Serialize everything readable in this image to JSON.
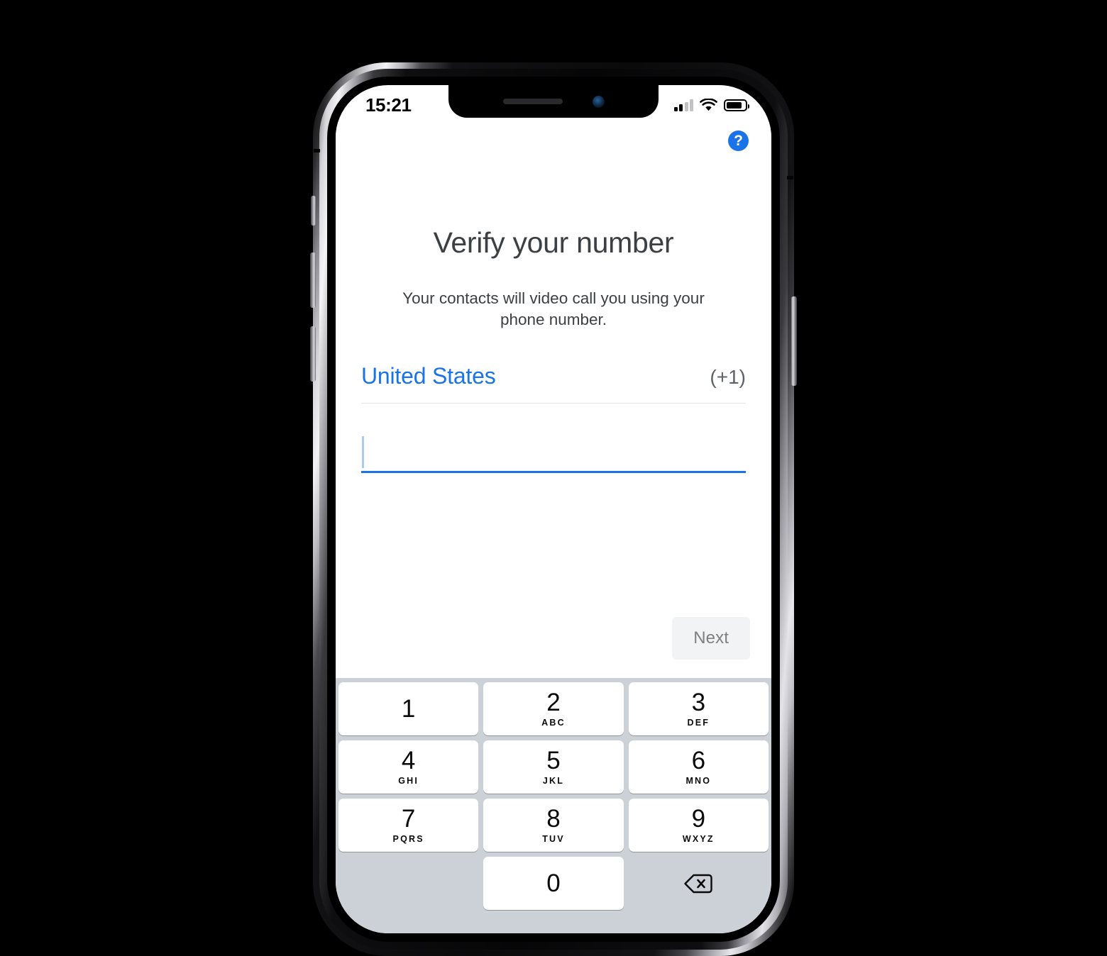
{
  "device": {
    "status_bar": {
      "time": "15:21",
      "signal_icon": "cellular-signal-icon",
      "signal_bars_filled": 2,
      "signal_bars_total": 4,
      "wifi_icon": "wifi-icon",
      "battery_icon": "battery-icon",
      "battery_level_pct": 84
    },
    "notch": {
      "speaker_icon": "earpiece-speaker-icon",
      "camera_icon": "front-camera-icon"
    }
  },
  "app": {
    "help_button": {
      "label": "?",
      "icon": "help-question-icon",
      "color": "#1a73e8"
    },
    "title": "Verify your number",
    "subtitle": "Your contacts will video call you using your phone number.",
    "country": {
      "name": "United States",
      "dial_code": "(+1)",
      "name_color": "#1a73e8",
      "code_color": "#5f6368"
    },
    "phone_input": {
      "value": "",
      "placeholder": "",
      "underline_color": "#1a73e8",
      "caret_color": "#a8cbf5"
    },
    "next_button": {
      "label": "Next",
      "enabled": false,
      "bg_color": "#f1f3f4",
      "text_color": "#7d8084"
    }
  },
  "keypad": {
    "background_color": "#ccd1d7",
    "rows": [
      [
        {
          "num": "1",
          "sub": ""
        },
        {
          "num": "2",
          "sub": "ABC"
        },
        {
          "num": "3",
          "sub": "DEF"
        }
      ],
      [
        {
          "num": "4",
          "sub": "GHI"
        },
        {
          "num": "5",
          "sub": "JKL"
        },
        {
          "num": "6",
          "sub": "MNO"
        }
      ],
      [
        {
          "num": "7",
          "sub": "PQRS"
        },
        {
          "num": "8",
          "sub": "TUV"
        },
        {
          "num": "9",
          "sub": "WXYZ"
        }
      ]
    ],
    "zero_key": {
      "num": "0",
      "sub": ""
    },
    "backspace": {
      "icon": "backspace-delete-icon",
      "label": ""
    }
  }
}
